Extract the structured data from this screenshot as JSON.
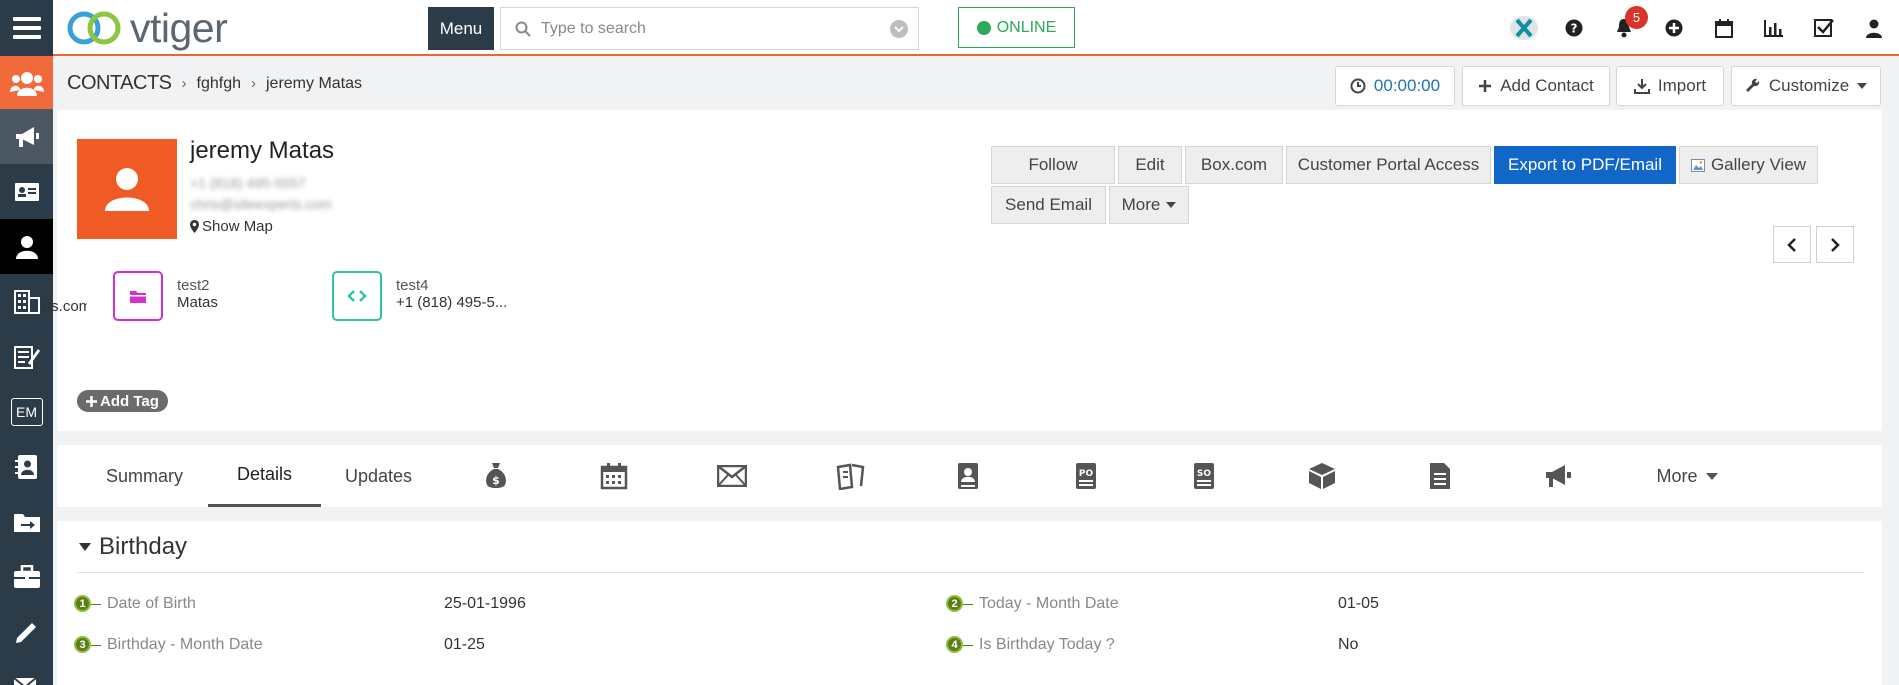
{
  "topbar": {
    "logo_text": "vtiger",
    "menu_label": "Menu",
    "search_placeholder": "Type to search",
    "online_label": "ONLINE",
    "notification_count": "5",
    "icons": [
      "vtiger-x-icon",
      "help-icon",
      "bell-icon",
      "plus-icon",
      "calendar-icon",
      "reports-icon",
      "tasks-icon",
      "user-icon"
    ]
  },
  "sidebar": {
    "items": [
      "contacts-group-icon",
      "marketing-megaphone-icon",
      "contact-card-icon",
      "contacts-person-icon",
      "organizations-icon",
      "documents-icon",
      "EM",
      "address-book-icon",
      "folder-transfer-icon",
      "briefcase-icon",
      "pencil-icon",
      "email-settings-icon"
    ],
    "em_label": "EM"
  },
  "breadcrumb": {
    "module": "CONTACTS",
    "filter": "fghfgh",
    "record": "jeremy Matas"
  },
  "header_buttons": {
    "timer": "00:00:00",
    "add_contact": "Add Contact",
    "import": "Import",
    "customize": "Customize"
  },
  "record": {
    "name": "jeremy Matas",
    "phone_blurred": "+1 (818) 495-5557",
    "email_blurred": "chris@siteexperts.com",
    "show_map": "Show Map"
  },
  "actions": {
    "follow": "Follow",
    "edit": "Edit",
    "box": "Box.com",
    "portal": "Customer Portal Access",
    "export": "Export to PDF/Email",
    "gallery": "Gallery View",
    "send_email": "Send Email",
    "more": "More"
  },
  "key_fields": {
    "truncated_email": "rts.com",
    "f1_label": "test2",
    "f1_value": "Matas",
    "f2_label": "test4",
    "f2_value": "+1 (818) 495-5..."
  },
  "tag": {
    "add_tag": "Add Tag"
  },
  "tabs": {
    "summary": "Summary",
    "details": "Details",
    "updates": "Updates",
    "more": "More",
    "icons": [
      "money-bag-icon",
      "calendar-icon",
      "envelope-icon",
      "tickets-icon",
      "contact-book-icon",
      "purchase-order-icon",
      "sales-order-icon",
      "box-icon",
      "document-icon",
      "megaphone-icon"
    ]
  },
  "details": {
    "section": "Birthday",
    "fields": [
      {
        "num": "1",
        "label": "Date of Birth",
        "value": "25-01-1996"
      },
      {
        "num": "2",
        "label": "Today - Month Date",
        "value": "01-05"
      },
      {
        "num": "3",
        "label": "Birthday - Month Date",
        "value": "01-25"
      },
      {
        "num": "4",
        "label": "Is Birthday Today ?",
        "value": "No"
      }
    ]
  },
  "colors": {
    "accent_orange": "#f05a24",
    "sidebar_dark": "#2c3b48",
    "primary_blue": "#1266c8",
    "online_green": "#2ea85a",
    "badge_red": "#d9342b"
  }
}
